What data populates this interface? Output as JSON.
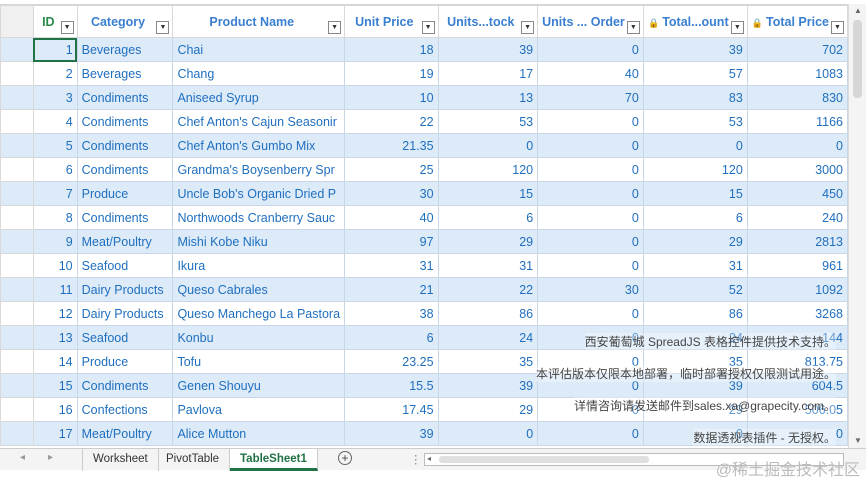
{
  "columns": [
    {
      "label": "ID",
      "lock": false
    },
    {
      "label": "Category",
      "lock": false
    },
    {
      "label": "Product Name",
      "lock": false
    },
    {
      "label": "Unit Price",
      "lock": false
    },
    {
      "label": "Units...tock",
      "lock": false
    },
    {
      "label": "Units ... Order",
      "lock": false
    },
    {
      "label": "Total...ount",
      "lock": true
    },
    {
      "label": "Total Price",
      "lock": true
    }
  ],
  "dropdown_glyph": "▼",
  "lock_glyph": "🔒",
  "rows": [
    [
      "1",
      "Beverages",
      "Chai",
      "18",
      "39",
      "0",
      "39",
      "702"
    ],
    [
      "2",
      "Beverages",
      "Chang",
      "19",
      "17",
      "40",
      "57",
      "1083"
    ],
    [
      "3",
      "Condiments",
      "Aniseed Syrup",
      "10",
      "13",
      "70",
      "83",
      "830"
    ],
    [
      "4",
      "Condiments",
      "Chef Anton's Cajun Seasonir",
      "22",
      "53",
      "0",
      "53",
      "1166"
    ],
    [
      "5",
      "Condiments",
      "Chef Anton's Gumbo Mix",
      "21.35",
      "0",
      "0",
      "0",
      "0"
    ],
    [
      "6",
      "Condiments",
      "Grandma's Boysenberry Spr",
      "25",
      "120",
      "0",
      "120",
      "3000"
    ],
    [
      "7",
      "Produce",
      "Uncle Bob's Organic Dried P",
      "30",
      "15",
      "0",
      "15",
      "450"
    ],
    [
      "8",
      "Condiments",
      "Northwoods Cranberry Sauc",
      "40",
      "6",
      "0",
      "6",
      "240"
    ],
    [
      "9",
      "Meat/Poultry",
      "Mishi Kobe Niku",
      "97",
      "29",
      "0",
      "29",
      "2813"
    ],
    [
      "10",
      "Seafood",
      "Ikura",
      "31",
      "31",
      "0",
      "31",
      "961"
    ],
    [
      "11",
      "Dairy Products",
      "Queso Cabrales",
      "21",
      "22",
      "30",
      "52",
      "1092"
    ],
    [
      "12",
      "Dairy Products",
      "Queso Manchego La Pastora",
      "38",
      "86",
      "0",
      "86",
      "3268"
    ],
    [
      "13",
      "Seafood",
      "Konbu",
      "6",
      "24",
      "0",
      "24",
      "144"
    ],
    [
      "14",
      "Produce",
      "Tofu",
      "23.25",
      "35",
      "0",
      "35",
      "813.75"
    ],
    [
      "15",
      "Condiments",
      "Genen Shouyu",
      "15.5",
      "39",
      "0",
      "39",
      "604.5"
    ],
    [
      "16",
      "Confections",
      "Pavlova",
      "17.45",
      "29",
      "0",
      "29",
      "506.05"
    ],
    [
      "17",
      "Meat/Poultry",
      "Alice Mutton",
      "39",
      "0",
      "0",
      "0",
      "0"
    ]
  ],
  "tabs": {
    "worksheet": "Worksheet",
    "pivot": "PivotTable",
    "active": "TableSheet1"
  },
  "watermark": [
    "西安葡萄城 SpreadJS 表格控件提供技术支持。",
    "本评估版本仅限本地部署，临时部署授权仅限测试用途。",
    "详情咨询请发送邮件到sales.xa@grapecity.com。",
    "数据透视表插件 - 无授权。"
  ],
  "signature": "@稀土掘金技术社区",
  "colors": {
    "accent": "#217346",
    "header": "#3a7fd0",
    "band": "#ddebf9"
  }
}
